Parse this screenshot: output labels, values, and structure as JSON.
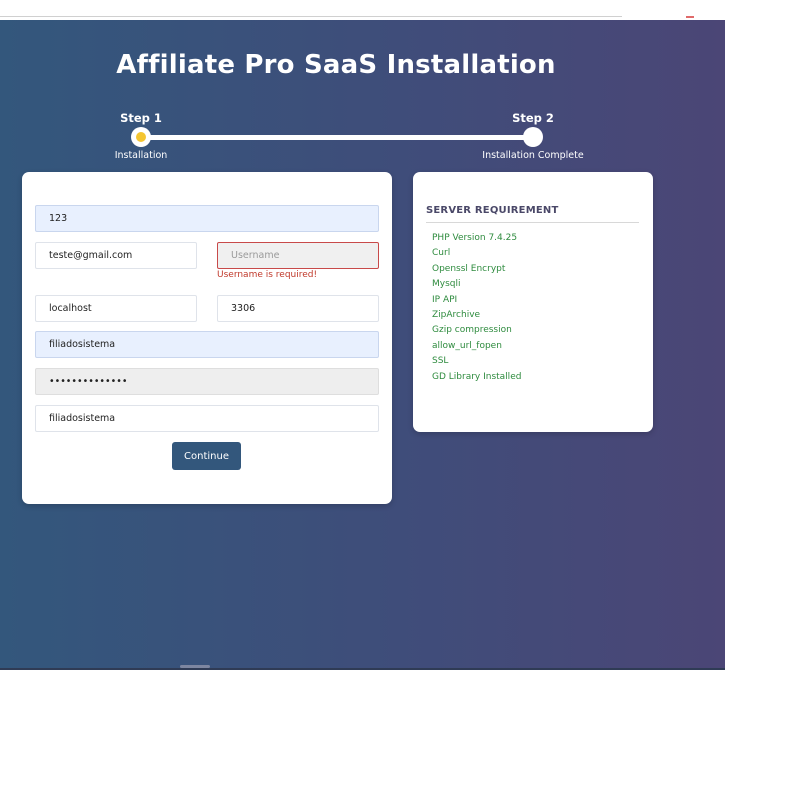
{
  "page": {
    "title": "Affiliate Pro SaaS Installation"
  },
  "steps": [
    {
      "title": "Step 1",
      "subtitle": "Installation",
      "state": "active"
    },
    {
      "title": "Step 2",
      "subtitle": "Installation Complete",
      "state": "pending"
    }
  ],
  "form": {
    "fields": [
      {
        "value": "123",
        "placeholder": ""
      },
      {
        "value": "teste@gmail.com",
        "placeholder": ""
      },
      {
        "value": "",
        "placeholder": "Username"
      },
      {
        "value": "localhost",
        "placeholder": ""
      },
      {
        "value": "3306",
        "placeholder": ""
      },
      {
        "value": "filiadosistema",
        "placeholder": ""
      },
      {
        "value": "••••••••••••••",
        "placeholder": ""
      },
      {
        "value": "filiadosistema",
        "placeholder": ""
      }
    ],
    "username_error": "Username is required!",
    "continue_label": "Continue"
  },
  "requirements": {
    "title": "SERVER REQUIREMENT",
    "items": [
      "PHP Version 7.4.25",
      "Curl",
      "Openssl Encrypt",
      "Mysqli",
      "IP API",
      "ZipArchive",
      "Gzip compression",
      "allow_url_fopen",
      "SSL",
      "GD Library Installed"
    ],
    "status_color": "#2e8b3e"
  },
  "colors": {
    "accent": "#33577c",
    "active_step": "#f4c531",
    "error": "#c0392b"
  }
}
